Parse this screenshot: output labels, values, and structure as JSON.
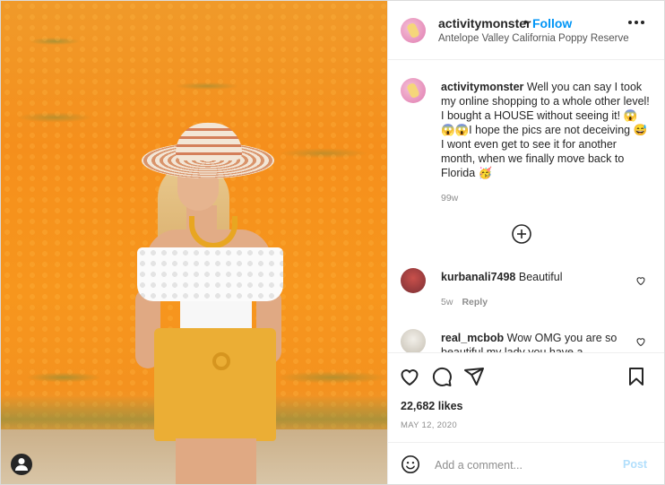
{
  "post": {
    "username": "activitymonster",
    "follow_separator": "•",
    "follow_label": "Follow",
    "location": "Antelope Valley California Poppy Reserve",
    "more_icon": "more-horizontal-icon"
  },
  "caption": {
    "username": "activitymonster",
    "text": " Well you can say I took my online shopping to a whole other level! I bought a HOUSE without seeing it! 😱😱😱I hope the pics are not deceiving 😅 I wont even get to see it for another month, when we finally move back to Florida 🥳",
    "time": "99w"
  },
  "comments": [
    {
      "username": "kurbanali7498",
      "text": " Beautiful",
      "time": "5w",
      "reply": "Reply"
    },
    {
      "username": "real_mcbob",
      "text": " Wow OMG you are so beautiful my lady you have a",
      "time": "",
      "reply": ""
    }
  ],
  "stats": {
    "likes": "22,682 likes",
    "date": "MAY 12, 2020"
  },
  "add_comment": {
    "placeholder": "Add a comment...",
    "post_label": "Post"
  },
  "colors": {
    "accent": "#0095f6",
    "post_disabled": "#b2dffc",
    "text": "#262626",
    "muted": "#8e8e8e"
  }
}
